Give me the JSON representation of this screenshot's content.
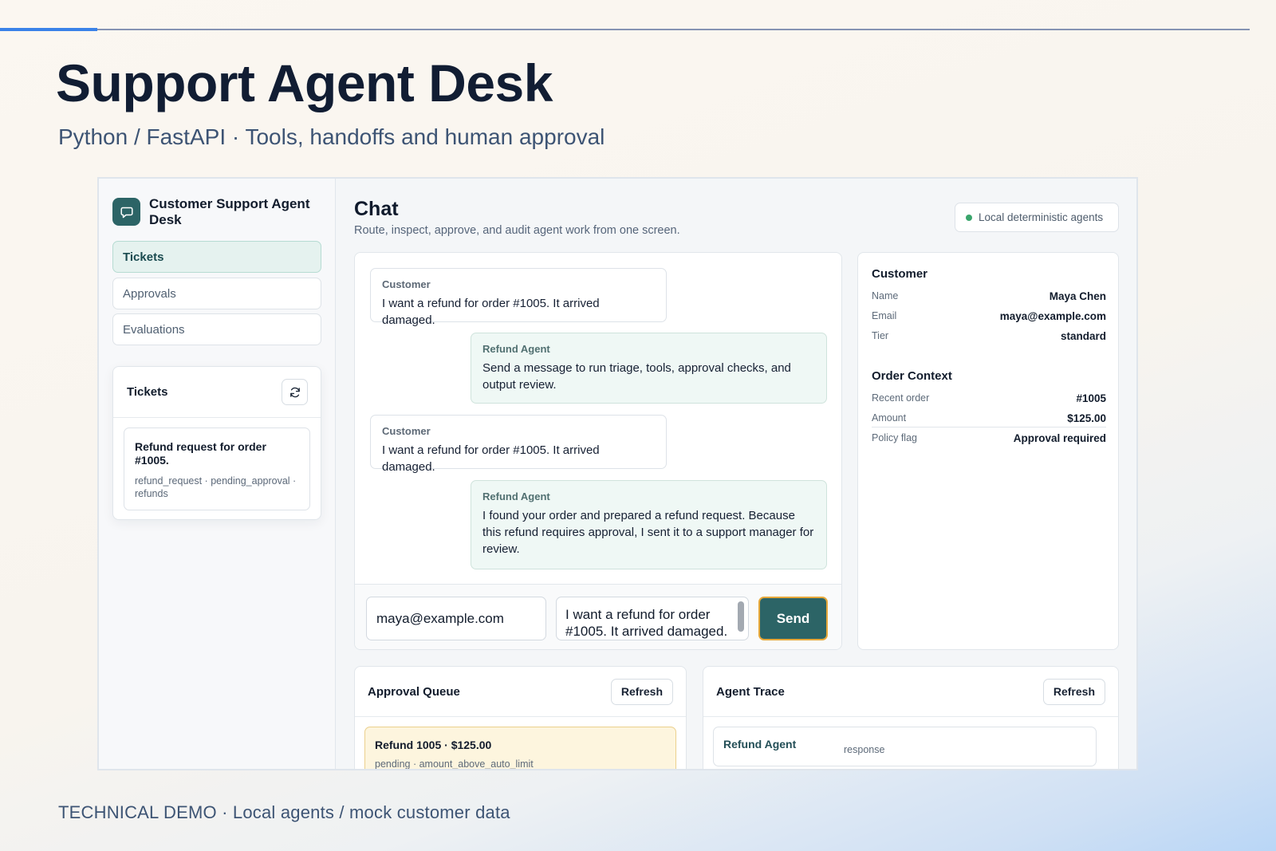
{
  "slide": {
    "title": "Support Agent Desk",
    "subtitle": "Python / FastAPI · Tools, handoffs and human approval",
    "footer": "TECHNICAL DEMO · Local agents / mock customer data",
    "accent_color": "#3a82e8"
  },
  "app": {
    "brand": {
      "name": "Customer Support Agent Desk",
      "icon": "chat-bubble-icon",
      "color": "#2c6466"
    },
    "nav": [
      "Tickets",
      "Approvals",
      "Evaluations"
    ],
    "tickets_card": {
      "title": "Tickets",
      "refresh_icon": "refresh-icon",
      "items": [
        {
          "title": "Refund request for order #1005.",
          "meta": "refund_request · pending_approval · refunds"
        }
      ]
    },
    "chat": {
      "title": "Chat",
      "subtitle": "Route, inspect, approve, and audit agent work from one screen.",
      "status_badge": "Local deterministic agents",
      "messages": [
        {
          "role": "Customer",
          "text": "I want a refund for order #1005. It arrived damaged."
        },
        {
          "role": "Refund Agent",
          "text": "Send a message to run triage, tools, approval checks, and output review."
        },
        {
          "role": "Customer",
          "text": "I want a refund for order #1005. It arrived damaged."
        },
        {
          "role": "Refund Agent",
          "text": "I found your order and prepared a refund request. Because this refund requires approval, I sent it to a support manager for review."
        }
      ],
      "composer": {
        "email_value": "maya@example.com",
        "message_value": "I want a refund for order #1005. It arrived damaged.",
        "send_label": "Send"
      }
    },
    "customer_panel": {
      "customer_title": "Customer",
      "customer_fields": [
        {
          "label": "Name",
          "value": "Maya Chen"
        },
        {
          "label": "Email",
          "value": "maya@example.com"
        },
        {
          "label": "Tier",
          "value": "standard"
        }
      ],
      "order_title": "Order Context",
      "order_fields": [
        {
          "label": "Recent order",
          "value": "#1005"
        },
        {
          "label": "Amount",
          "value": "$125.00"
        },
        {
          "label": "Policy flag",
          "value": "Approval required"
        }
      ]
    },
    "approval_queue": {
      "title": "Approval Queue",
      "refresh_label": "Refresh",
      "items": [
        {
          "title": "Refund 1005 · $125.00",
          "meta": "pending · amount_above_auto_limit"
        }
      ]
    },
    "agent_trace": {
      "title": "Agent Trace",
      "refresh_label": "Refresh",
      "items": [
        {
          "agent": "Refund Agent",
          "type": "response"
        }
      ]
    }
  }
}
